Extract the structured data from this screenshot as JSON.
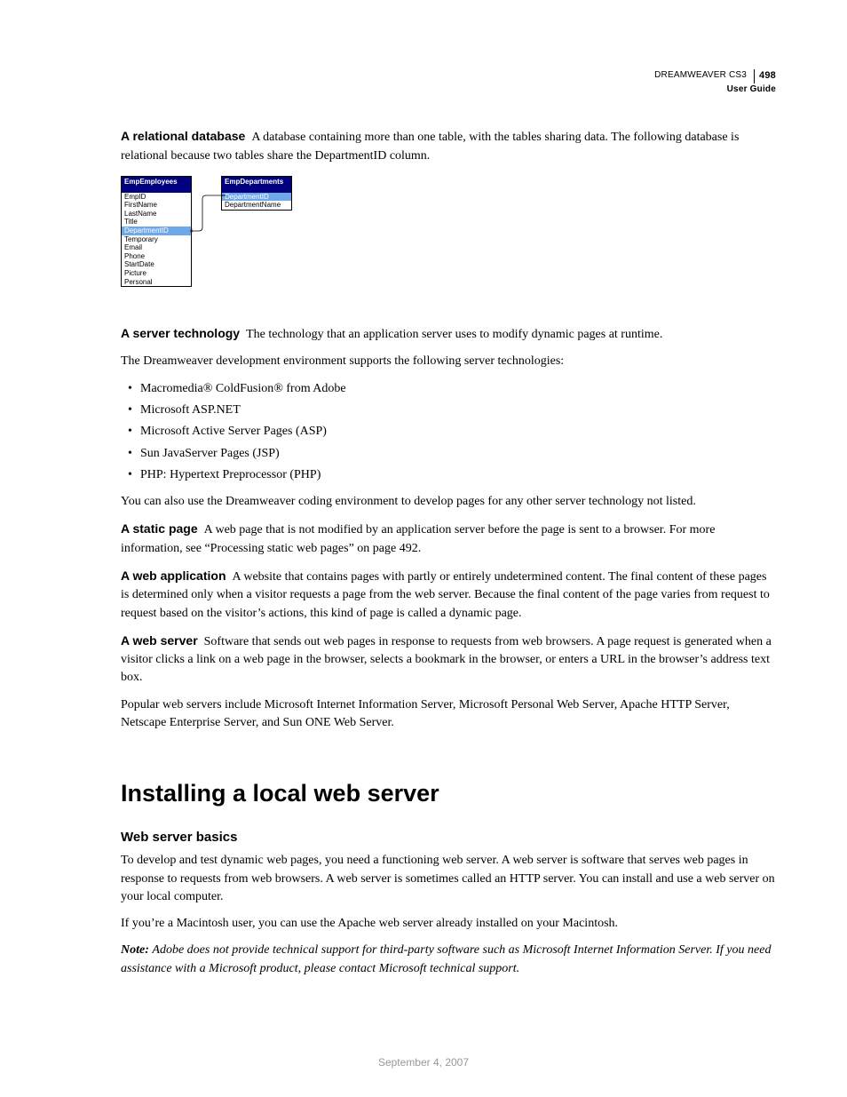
{
  "header": {
    "product": "DREAMWEAVER CS3",
    "subtitle": "User Guide",
    "page_number": "498"
  },
  "defs": {
    "relational_db": {
      "term": "A relational database",
      "text": "A database containing more than one table, with the tables sharing data. The following database is relational because two tables share the DepartmentID column."
    },
    "server_tech": {
      "term": "A server technology",
      "text": "The technology that an application server uses to modify dynamic pages at runtime."
    },
    "static_page": {
      "term": "A static page",
      "text": "A web page that is not modified by an application server before the page is sent to a browser. For more information, see “Processing static web pages” on page 492."
    },
    "web_app": {
      "term": "A web application",
      "text": "A website that contains pages with partly or entirely undetermined content. The final content of these pages is determined only when a visitor requests a page from the web server. Because the final content of the page varies from request to request based on the visitor’s actions, this kind of page is called a dynamic page."
    },
    "web_server": {
      "term": "A web server",
      "text": "Software that sends out web pages in response to requests from web browsers. A page request is generated when a visitor clicks a link on a web page in the browser, selects a bookmark in the browser, or enters a URL in the browser’s address text box."
    }
  },
  "server_tech_intro": "The Dreamweaver development environment supports the following server technologies:",
  "server_tech_list": [
    "Macromedia® ColdFusion® from Adobe",
    "Microsoft ASP.NET",
    "Microsoft Active Server Pages (ASP)",
    "Sun JavaServer Pages (JSP)",
    "PHP: Hypertext Preprocessor (PHP)"
  ],
  "server_tech_followup": "You can also use the Dreamweaver coding environment to develop pages for any other server technology not listed.",
  "web_server_followup": "Popular web servers include Microsoft Internet Information Server, Microsoft Personal Web Server, Apache HTTP Server, Netscape Enterprise Server, and Sun ONE Web Server.",
  "section_heading": "Installing a local web server",
  "sub_heading": "Web server basics",
  "basics_p1": "To develop and test dynamic web pages, you need a functioning web server. A web server is software that serves web pages in response to requests from web browsers. A web server is sometimes called an HTTP server. You can install and use a web server on your local computer.",
  "basics_p2": "If you’re a Macintosh user, you can use the Apache web server already installed on your Macintosh.",
  "note": {
    "label": "Note:",
    "text": "Adobe does not provide technical support for third-party software such as Microsoft Internet Information Server. If you need assistance with a Microsoft product, please contact Microsoft technical support."
  },
  "diagram": {
    "left": {
      "title": "EmpEmployees",
      "fields": [
        "EmpID",
        "FirstName",
        "LastName",
        "Title",
        "DepartmentID",
        "Temporary",
        "Email",
        "Phone",
        "StartDate",
        "Picture",
        "Personal"
      ],
      "highlight": "DepartmentID"
    },
    "right": {
      "title": "EmpDepartments",
      "fields": [
        "DepartmentID",
        "DepartmentName"
      ],
      "highlight": "DepartmentID"
    }
  },
  "footer_date": "September 4, 2007"
}
